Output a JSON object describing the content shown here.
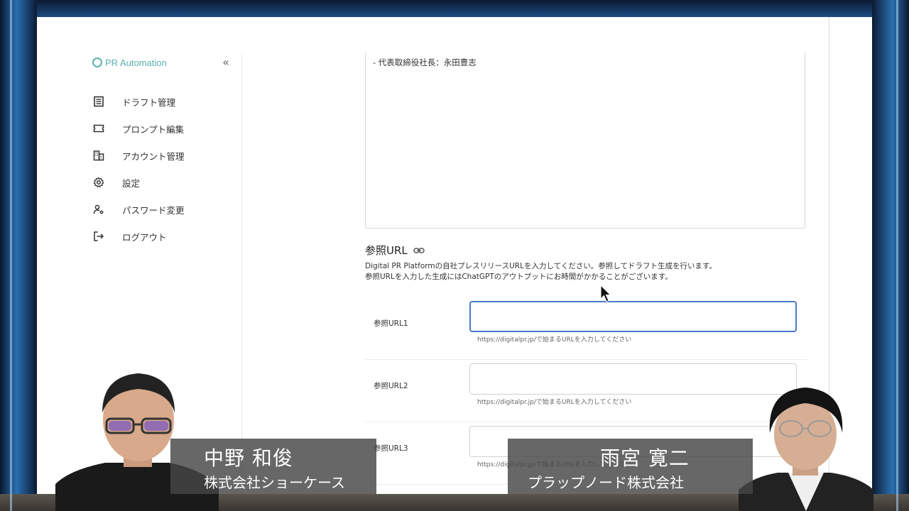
{
  "sidebar": {
    "logo_text": "PR Automation",
    "collapse_glyph": "«",
    "items": [
      {
        "label": "ドラフト管理",
        "icon": "document-list-icon"
      },
      {
        "label": "プロンプト編集",
        "icon": "ticket-icon"
      },
      {
        "label": "アカウント管理",
        "icon": "building-icon"
      },
      {
        "label": "設定",
        "icon": "gear-icon"
      },
      {
        "label": "パスワード変更",
        "icon": "user-key-icon"
      },
      {
        "label": "ログアウト",
        "icon": "logout-icon"
      }
    ]
  },
  "main": {
    "textarea_value": "- 代表取締役社長：永田豊志",
    "reference_section": {
      "title": "参照URL",
      "description_line1": "Digital PR Platformの自社プレスリリースURLを入力してください。参照してドラフト生成を行います。",
      "description_line2": "参照URLを入力した生成にはChatGPTのアウトプットにお時間がかかることがございます。",
      "fields": [
        {
          "label": "参照URL1",
          "value": "",
          "hint": "https://digitalpr.jp/で始まるURLを入力してください"
        },
        {
          "label": "参照URL2",
          "value": "",
          "hint": "https://digitalpr.jp/で始まるURLを入力してください"
        },
        {
          "label": "参照URL3",
          "value": "",
          "hint": "https://digitalpr.jp/で始まるURLを入力してください"
        }
      ]
    }
  },
  "overlay": {
    "left_person": {
      "name": "中野 和俊",
      "company": "株式会社ショーケース"
    },
    "right_person": {
      "name": "雨宮 寛二",
      "company": "プラップノード株式会社"
    }
  },
  "colors": {
    "accent": "#4a78c8",
    "logo": "#5ab0ad",
    "caption_bg": "#464646"
  }
}
